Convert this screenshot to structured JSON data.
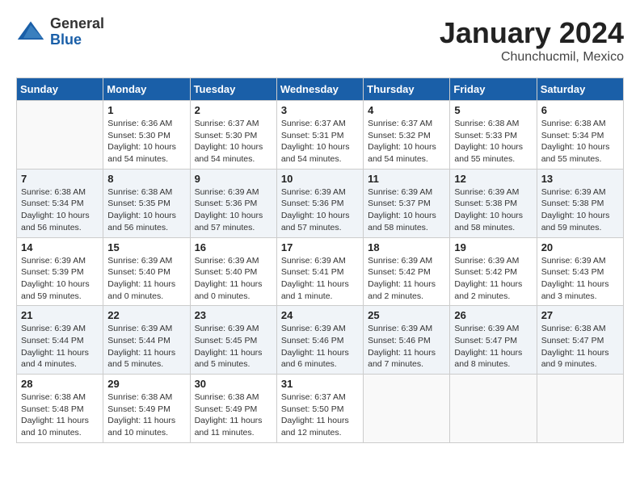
{
  "header": {
    "logo_general": "General",
    "logo_blue": "Blue",
    "month_title": "January 2024",
    "location": "Chunchucmil, Mexico"
  },
  "weekdays": [
    "Sunday",
    "Monday",
    "Tuesday",
    "Wednesday",
    "Thursday",
    "Friday",
    "Saturday"
  ],
  "weeks": [
    [
      {
        "day": "",
        "empty": true
      },
      {
        "day": "1",
        "sunrise": "6:36 AM",
        "sunset": "5:30 PM",
        "daylight": "10 hours and 54 minutes."
      },
      {
        "day": "2",
        "sunrise": "6:37 AM",
        "sunset": "5:30 PM",
        "daylight": "10 hours and 54 minutes."
      },
      {
        "day": "3",
        "sunrise": "6:37 AM",
        "sunset": "5:31 PM",
        "daylight": "10 hours and 54 minutes."
      },
      {
        "day": "4",
        "sunrise": "6:37 AM",
        "sunset": "5:32 PM",
        "daylight": "10 hours and 54 minutes."
      },
      {
        "day": "5",
        "sunrise": "6:38 AM",
        "sunset": "5:33 PM",
        "daylight": "10 hours and 55 minutes."
      },
      {
        "day": "6",
        "sunrise": "6:38 AM",
        "sunset": "5:34 PM",
        "daylight": "10 hours and 55 minutes."
      }
    ],
    [
      {
        "day": "7",
        "sunrise": "6:38 AM",
        "sunset": "5:34 PM",
        "daylight": "10 hours and 56 minutes."
      },
      {
        "day": "8",
        "sunrise": "6:38 AM",
        "sunset": "5:35 PM",
        "daylight": "10 hours and 56 minutes."
      },
      {
        "day": "9",
        "sunrise": "6:39 AM",
        "sunset": "5:36 PM",
        "daylight": "10 hours and 57 minutes."
      },
      {
        "day": "10",
        "sunrise": "6:39 AM",
        "sunset": "5:36 PM",
        "daylight": "10 hours and 57 minutes."
      },
      {
        "day": "11",
        "sunrise": "6:39 AM",
        "sunset": "5:37 PM",
        "daylight": "10 hours and 58 minutes."
      },
      {
        "day": "12",
        "sunrise": "6:39 AM",
        "sunset": "5:38 PM",
        "daylight": "10 hours and 58 minutes."
      },
      {
        "day": "13",
        "sunrise": "6:39 AM",
        "sunset": "5:38 PM",
        "daylight": "10 hours and 59 minutes."
      }
    ],
    [
      {
        "day": "14",
        "sunrise": "6:39 AM",
        "sunset": "5:39 PM",
        "daylight": "10 hours and 59 minutes."
      },
      {
        "day": "15",
        "sunrise": "6:39 AM",
        "sunset": "5:40 PM",
        "daylight": "11 hours and 0 minutes."
      },
      {
        "day": "16",
        "sunrise": "6:39 AM",
        "sunset": "5:40 PM",
        "daylight": "11 hours and 0 minutes."
      },
      {
        "day": "17",
        "sunrise": "6:39 AM",
        "sunset": "5:41 PM",
        "daylight": "11 hours and 1 minute."
      },
      {
        "day": "18",
        "sunrise": "6:39 AM",
        "sunset": "5:42 PM",
        "daylight": "11 hours and 2 minutes."
      },
      {
        "day": "19",
        "sunrise": "6:39 AM",
        "sunset": "5:42 PM",
        "daylight": "11 hours and 2 minutes."
      },
      {
        "day": "20",
        "sunrise": "6:39 AM",
        "sunset": "5:43 PM",
        "daylight": "11 hours and 3 minutes."
      }
    ],
    [
      {
        "day": "21",
        "sunrise": "6:39 AM",
        "sunset": "5:44 PM",
        "daylight": "11 hours and 4 minutes."
      },
      {
        "day": "22",
        "sunrise": "6:39 AM",
        "sunset": "5:44 PM",
        "daylight": "11 hours and 5 minutes."
      },
      {
        "day": "23",
        "sunrise": "6:39 AM",
        "sunset": "5:45 PM",
        "daylight": "11 hours and 5 minutes."
      },
      {
        "day": "24",
        "sunrise": "6:39 AM",
        "sunset": "5:46 PM",
        "daylight": "11 hours and 6 minutes."
      },
      {
        "day": "25",
        "sunrise": "6:39 AM",
        "sunset": "5:46 PM",
        "daylight": "11 hours and 7 minutes."
      },
      {
        "day": "26",
        "sunrise": "6:39 AM",
        "sunset": "5:47 PM",
        "daylight": "11 hours and 8 minutes."
      },
      {
        "day": "27",
        "sunrise": "6:38 AM",
        "sunset": "5:47 PM",
        "daylight": "11 hours and 9 minutes."
      }
    ],
    [
      {
        "day": "28",
        "sunrise": "6:38 AM",
        "sunset": "5:48 PM",
        "daylight": "11 hours and 10 minutes."
      },
      {
        "day": "29",
        "sunrise": "6:38 AM",
        "sunset": "5:49 PM",
        "daylight": "11 hours and 10 minutes."
      },
      {
        "day": "30",
        "sunrise": "6:38 AM",
        "sunset": "5:49 PM",
        "daylight": "11 hours and 11 minutes."
      },
      {
        "day": "31",
        "sunrise": "6:37 AM",
        "sunset": "5:50 PM",
        "daylight": "11 hours and 12 minutes."
      },
      {
        "day": "",
        "empty": true
      },
      {
        "day": "",
        "empty": true
      },
      {
        "day": "",
        "empty": true
      }
    ]
  ]
}
